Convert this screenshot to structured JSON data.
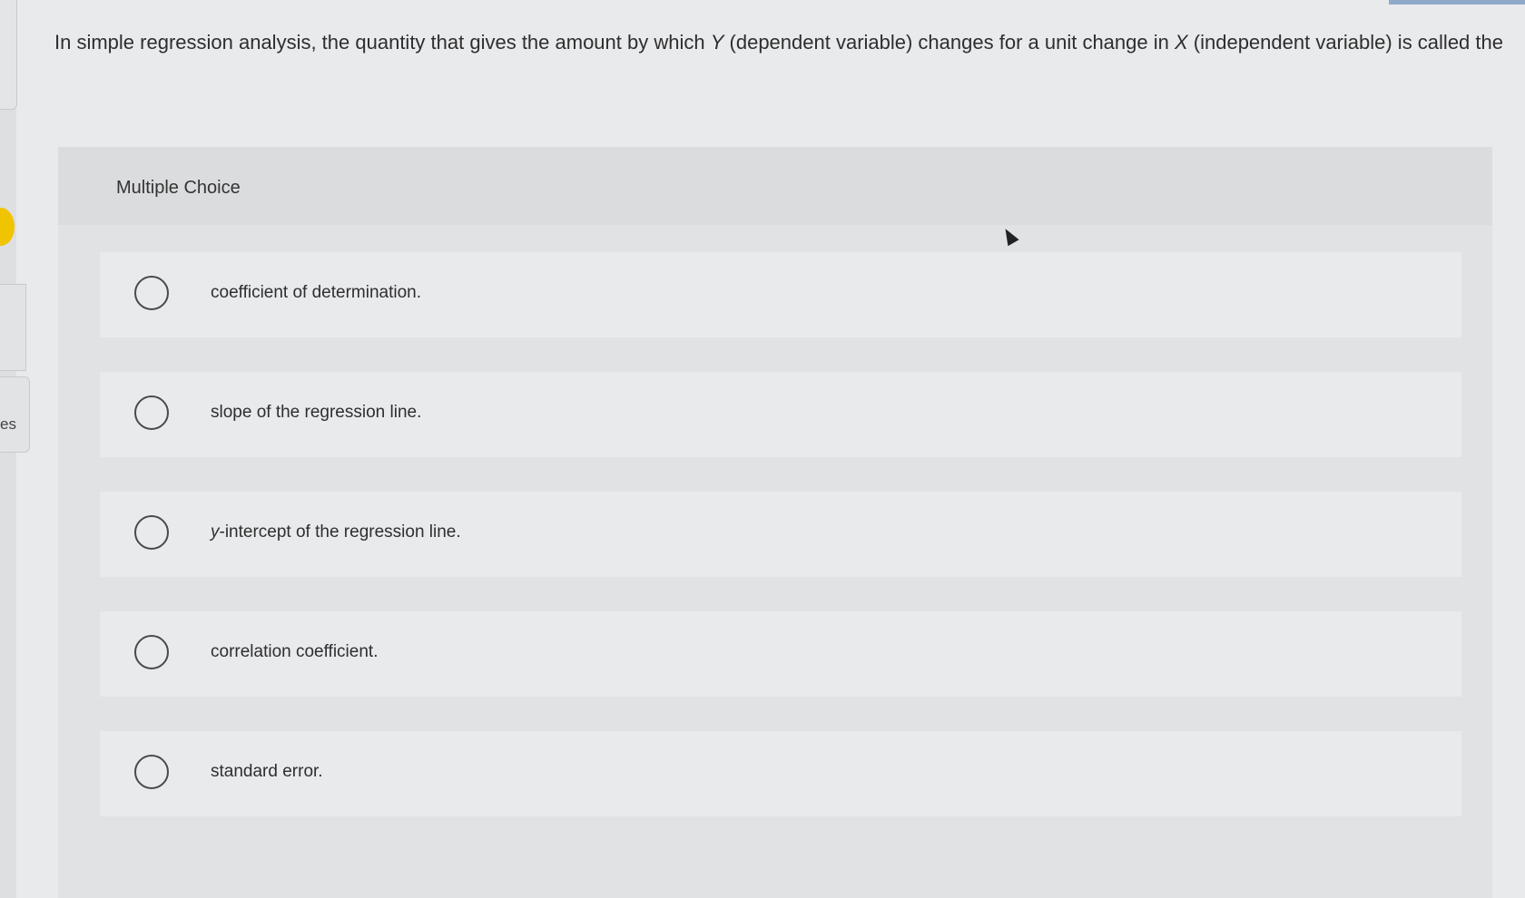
{
  "sidebar": {
    "partial_label": "es"
  },
  "question": {
    "text_part1": "In simple regression analysis, the quantity that gives the amount by which ",
    "var_y": "Y",
    "text_part2": " (dependent variable) changes for a unit change in ",
    "var_x": "X",
    "text_part3": " (independent variable) is called the"
  },
  "multiple_choice": {
    "title": "Multiple Choice",
    "options": [
      {
        "label": "coefficient of determination."
      },
      {
        "label": "slope of the regression line."
      },
      {
        "label_var": "y",
        "label_rest": "-intercept of the regression line."
      },
      {
        "label": "correlation coefficient."
      },
      {
        "label": "standard error."
      }
    ]
  },
  "colors": {
    "accent_yellow": "#f0c400",
    "radio_border": "#4a4a4a"
  }
}
